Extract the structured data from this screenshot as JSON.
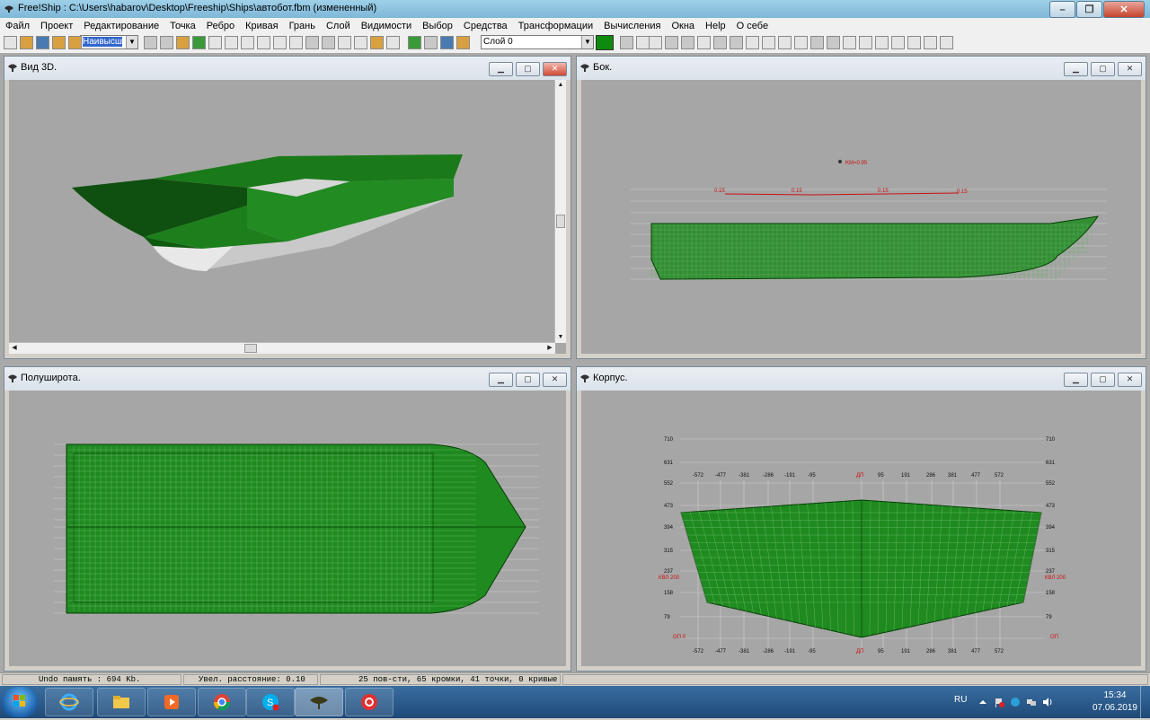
{
  "window": {
    "title": "Free!Ship  : C:\\Users\\habarov\\Desktop\\Freeship\\Ships\\автобот.fbm (измененный)",
    "min_glyph": "–",
    "max_glyph": "❐",
    "close_glyph": "✕"
  },
  "menu": [
    "Файл",
    "Проект",
    "Редактирование",
    "Точка",
    "Ребро",
    "Кривая",
    "Грань",
    "Слой",
    "Видимости",
    "Выбор",
    "Средства",
    "Трансформации",
    "Вычисления",
    "Окна",
    "Help",
    "О себе"
  ],
  "toolbar": {
    "precision_combo": "Наивысш",
    "layer_combo": "Слой 0",
    "layer_color": "#0e8a0e"
  },
  "views": {
    "v3d": {
      "title": "Вид 3D."
    },
    "side": {
      "title": "Бок.",
      "km_label": "KM=0.95",
      "curve_labels": [
        "0.15",
        "0.15",
        "0.15",
        "0.15"
      ]
    },
    "half": {
      "title": "Полуширота."
    },
    "body": {
      "title": "Корпус.",
      "left_ticks": [
        "710",
        "631",
        "552",
        "473",
        "394",
        "315",
        "237",
        "158",
        "79"
      ],
      "right_ticks": [
        "710",
        "631",
        "552",
        "473",
        "394",
        "315",
        "237",
        "158",
        "79"
      ],
      "top_station_labels": [
        "-572",
        "-477",
        "-381",
        "-286",
        "-191",
        "-95",
        "ДП",
        "95",
        "191",
        "286",
        "381",
        "477",
        "572"
      ],
      "bottom_station_labels": [
        "-572",
        "-477",
        "-381",
        "-286",
        "-191",
        "-95",
        "ДП",
        "95",
        "191",
        "286",
        "381",
        "477",
        "572"
      ],
      "kvl_left": "КВЛ 200",
      "kvl_right": "КВЛ 200",
      "op_left": "ОП 0",
      "op_right": "ОП"
    }
  },
  "status": {
    "undo": "Undo память : 694 Kb.",
    "distance": "Увел. расстояние: 0.10",
    "counts": "25 пов-сти, 65 кромки, 41 точки, 0 кривые"
  },
  "taskbar": {
    "lang": "RU",
    "time": "15:34",
    "date": "07.06.2019"
  },
  "colors": {
    "hull_green": "#1f8a1f",
    "hull_dark": "#0b4a0b",
    "hull_grey": "#d8d8d8",
    "accent_red": "#cc1111"
  }
}
